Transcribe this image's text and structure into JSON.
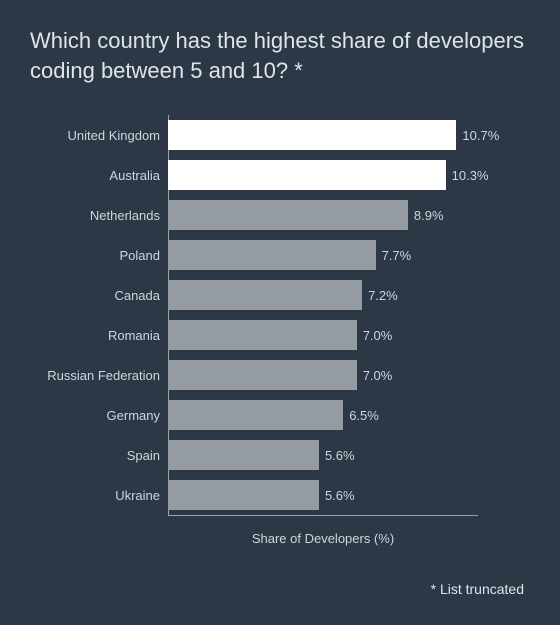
{
  "title": "Which country has the highest share of developers coding between 5 and 10? *",
  "footnote": "* List truncated",
  "chart_data": {
    "type": "bar",
    "orientation": "horizontal",
    "categories": [
      "United Kingdom",
      "Australia",
      "Netherlands",
      "Poland",
      "Canada",
      "Romania",
      "Russian Federation",
      "Germany",
      "Spain",
      "Ukraine"
    ],
    "values": [
      10.7,
      10.3,
      8.9,
      7.7,
      7.2,
      7.0,
      7.0,
      6.5,
      5.6,
      5.6
    ],
    "value_labels": [
      "10.7%",
      "10.3%",
      "8.9%",
      "7.7%",
      "7.2%",
      "7.0%",
      "7.0%",
      "6.5%",
      "5.6%",
      "5.6%"
    ],
    "highlight": [
      true,
      true,
      false,
      false,
      false,
      false,
      false,
      false,
      false,
      false
    ],
    "xlabel": "Share of Developers (%)",
    "ylabel": "",
    "title": "",
    "xlim": [
      0,
      11.5
    ]
  }
}
